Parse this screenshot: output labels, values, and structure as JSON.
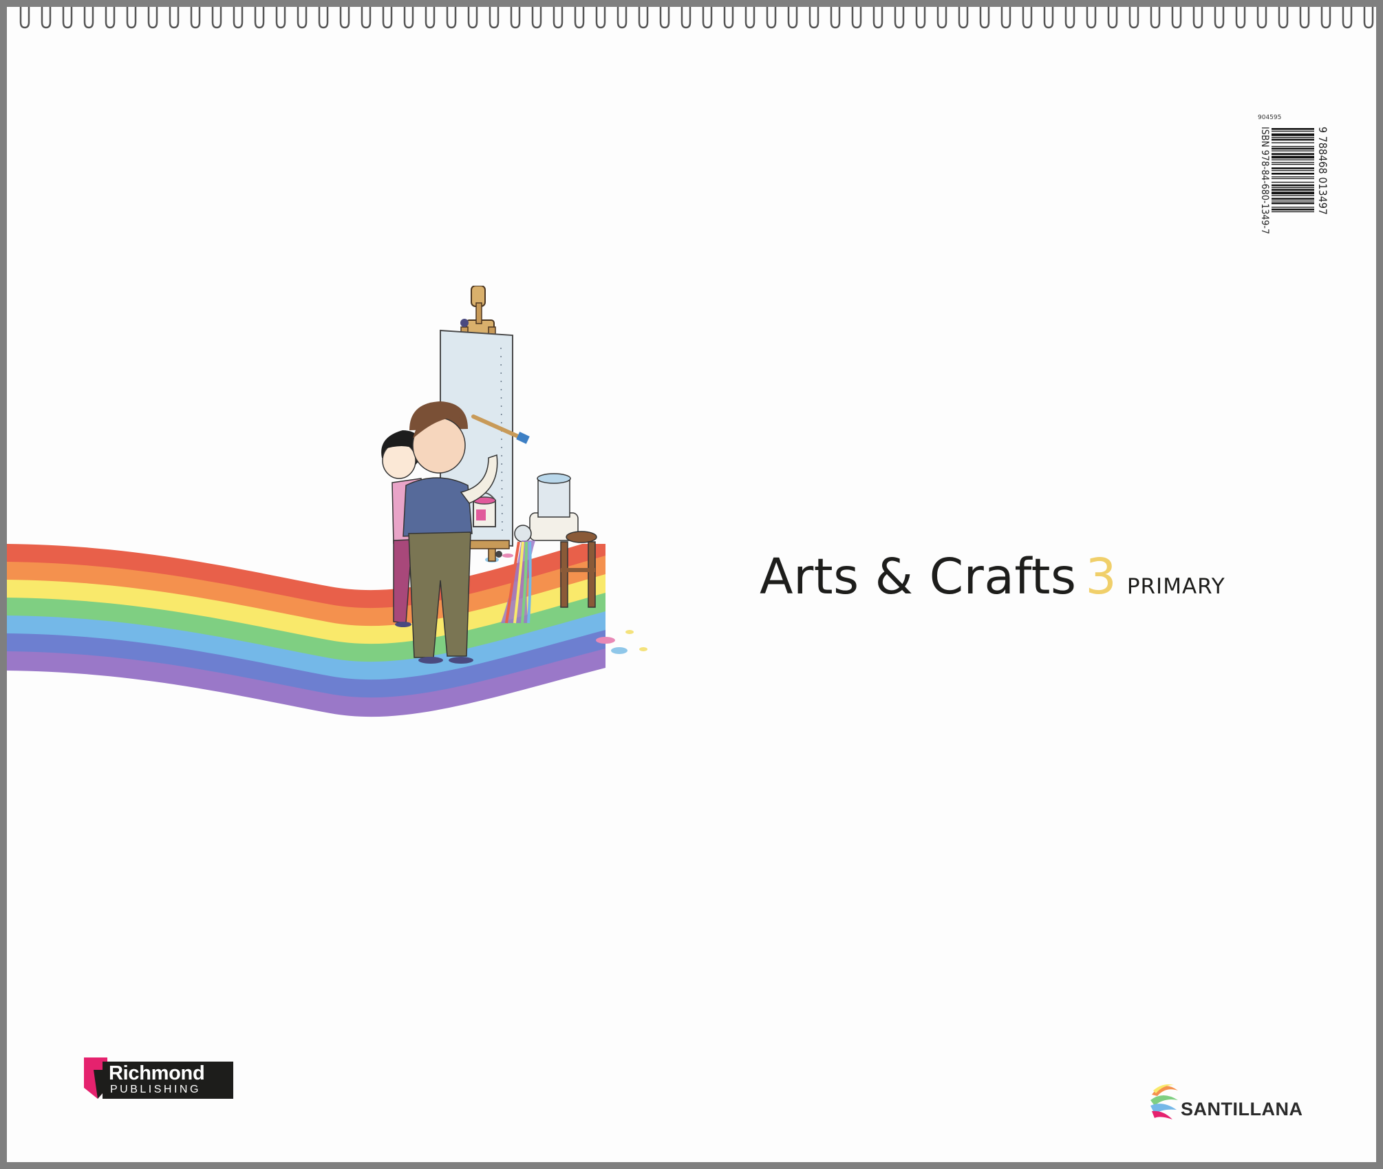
{
  "cover": {
    "title": "Arts & Crafts",
    "number": "3",
    "level": "PRIMARY",
    "colors": {
      "background": "#fdfdfd",
      "frame": "#7f7f7f",
      "title": "#1d1d1b",
      "number_accent": "#f0cf6a"
    }
  },
  "barcode": {
    "code": "904595",
    "isbn": "ISBN 978-84-680-1349-7",
    "digits": "9 788468 013497"
  },
  "illustration": {
    "rainbow_colors": [
      "#e8604a",
      "#f4914e",
      "#f9e96b",
      "#7fcf82",
      "#74b8e8",
      "#6d7fd0",
      "#9a78c8"
    ]
  },
  "publisher": {
    "name": "Richmond",
    "tagline": "PUBLISHING",
    "brand_color": "#e5226e"
  },
  "distributor": {
    "name": "SANTILLANA"
  }
}
